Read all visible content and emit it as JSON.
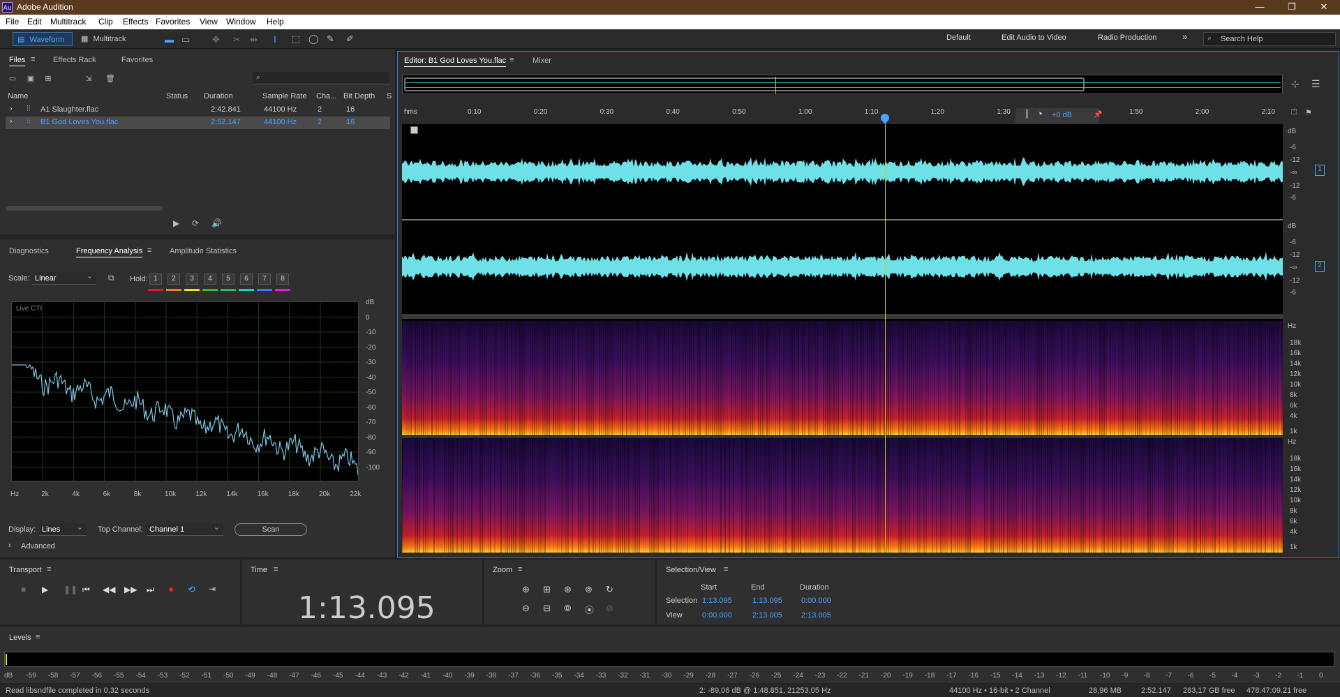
{
  "titlebar": {
    "app_icon": "Au",
    "title": "Adobe Audition"
  },
  "menu": [
    "File",
    "Edit",
    "Multitrack",
    "Clip",
    "Effects",
    "Favorites",
    "View",
    "Window",
    "Help"
  ],
  "toolbar": {
    "waveform": "Waveform",
    "multitrack": "Multitrack"
  },
  "workspaces": [
    "Default",
    "Edit Audio to Video",
    "Radio Production"
  ],
  "search_help": "Search Help",
  "files_panel": {
    "tabs": [
      "Files",
      "Effects Rack",
      "Favorites"
    ],
    "columns": [
      "Name",
      "Status",
      "Duration",
      "Sample Rate",
      "Cha...",
      "Bit Depth",
      "S"
    ],
    "rows": [
      {
        "name": "A1 Slaughter.flac",
        "duration": "2:42.841",
        "rate": "44100 Hz",
        "channels": "2",
        "bits": "16"
      },
      {
        "name": "B1 God Loves You.flac",
        "duration": "2:52.147",
        "rate": "44100 Hz",
        "channels": "2",
        "bits": "16"
      }
    ]
  },
  "analysis_panel": {
    "tabs": [
      "Diagnostics",
      "Frequency Analysis",
      "Amplitude Statistics"
    ],
    "scale_label": "Scale:",
    "scale_value": "Linear",
    "hold_label": "Hold:",
    "hold_buttons": [
      "1",
      "2",
      "3",
      "4",
      "5",
      "6",
      "7",
      "8"
    ],
    "hold_colors": [
      "#e02020",
      "#f08020",
      "#f0e020",
      "#30c030",
      "#20c060",
      "#20d0d0",
      "#3080f0",
      "#e020e0"
    ],
    "graph_label": "Live CTI",
    "db_ticks": [
      "dB",
      "0",
      "-10",
      "-20",
      "-30",
      "-40",
      "-50",
      "-60",
      "-70",
      "-80",
      "-90",
      "-100"
    ],
    "freq_ticks": [
      "Hz",
      "2k",
      "4k",
      "6k",
      "8k",
      "10k",
      "12k",
      "14k",
      "16k",
      "18k",
      "20k",
      "22k"
    ],
    "display_label": "Display:",
    "display_value": "Lines",
    "top_channel_label": "Top Channel:",
    "top_channel_value": "Channel 1",
    "scan": "Scan",
    "advanced": "Advanced"
  },
  "editor": {
    "tab": "Editor: B1 God Loves You.flac",
    "mixer": "Mixer",
    "ruler": [
      "hms",
      "0:10",
      "0:20",
      "0:30",
      "0:40",
      "0:50",
      "1:00",
      "1:10",
      "1:20",
      "1:30",
      "1:40",
      "1:50",
      "2:00",
      "2:10"
    ],
    "gain": "+0 dB",
    "db_scale": [
      "dB",
      "-6",
      "-12",
      "-∞",
      "-12",
      "-6"
    ],
    "channel_numbers": [
      "1",
      "2"
    ],
    "hz_scale": [
      "Hz",
      "18k",
      "16k",
      "14k",
      "12k",
      "10k",
      "8k",
      "6k",
      "4k",
      "1k"
    ]
  },
  "transport": {
    "title": "Transport"
  },
  "time": {
    "title": "Time",
    "value": "1:13.095"
  },
  "zoom": {
    "title": "Zoom"
  },
  "selection": {
    "title": "Selection/View",
    "headers": [
      "Start",
      "End",
      "Duration"
    ],
    "selection_label": "Selection",
    "view_label": "View",
    "sel_start": "1:13.095",
    "sel_end": "1:13.095",
    "sel_dur": "0:00.000",
    "view_start": "0:00.000",
    "view_end": "2:13.005",
    "view_dur": "2:13.005"
  },
  "levels": {
    "title": "Levels",
    "scale": [
      "dB",
      "-59",
      "-58",
      "-57",
      "-56",
      "-55",
      "-54",
      "-53",
      "-52",
      "-51",
      "-50",
      "-49",
      "-48",
      "-47",
      "-46",
      "-45",
      "-44",
      "-43",
      "-42",
      "-41",
      "-40",
      "-39",
      "-38",
      "-37",
      "-36",
      "-35",
      "-34",
      "-33",
      "-32",
      "-31",
      "-30",
      "-29",
      "-28",
      "-27",
      "-26",
      "-25",
      "-24",
      "-23",
      "-22",
      "-21",
      "-20",
      "-19",
      "-18",
      "-17",
      "-16",
      "-15",
      "-14",
      "-13",
      "-12",
      "-11",
      "-10",
      "-9",
      "-8",
      "-7",
      "-6",
      "-5",
      "-4",
      "-3",
      "-2",
      "-1",
      "0"
    ]
  },
  "status": {
    "left": "Read libsndfile completed in 0,32 seconds",
    "cursor": "2: -89,06 dB @ 1:48.851, 21253,05 Hz",
    "format": "44100 Hz • 16-bit • 2 Channel",
    "size": "28,96 MB",
    "duration": "2:52.147",
    "free": "283,17 GB free",
    "free_time": "478:47:09.21 free"
  }
}
